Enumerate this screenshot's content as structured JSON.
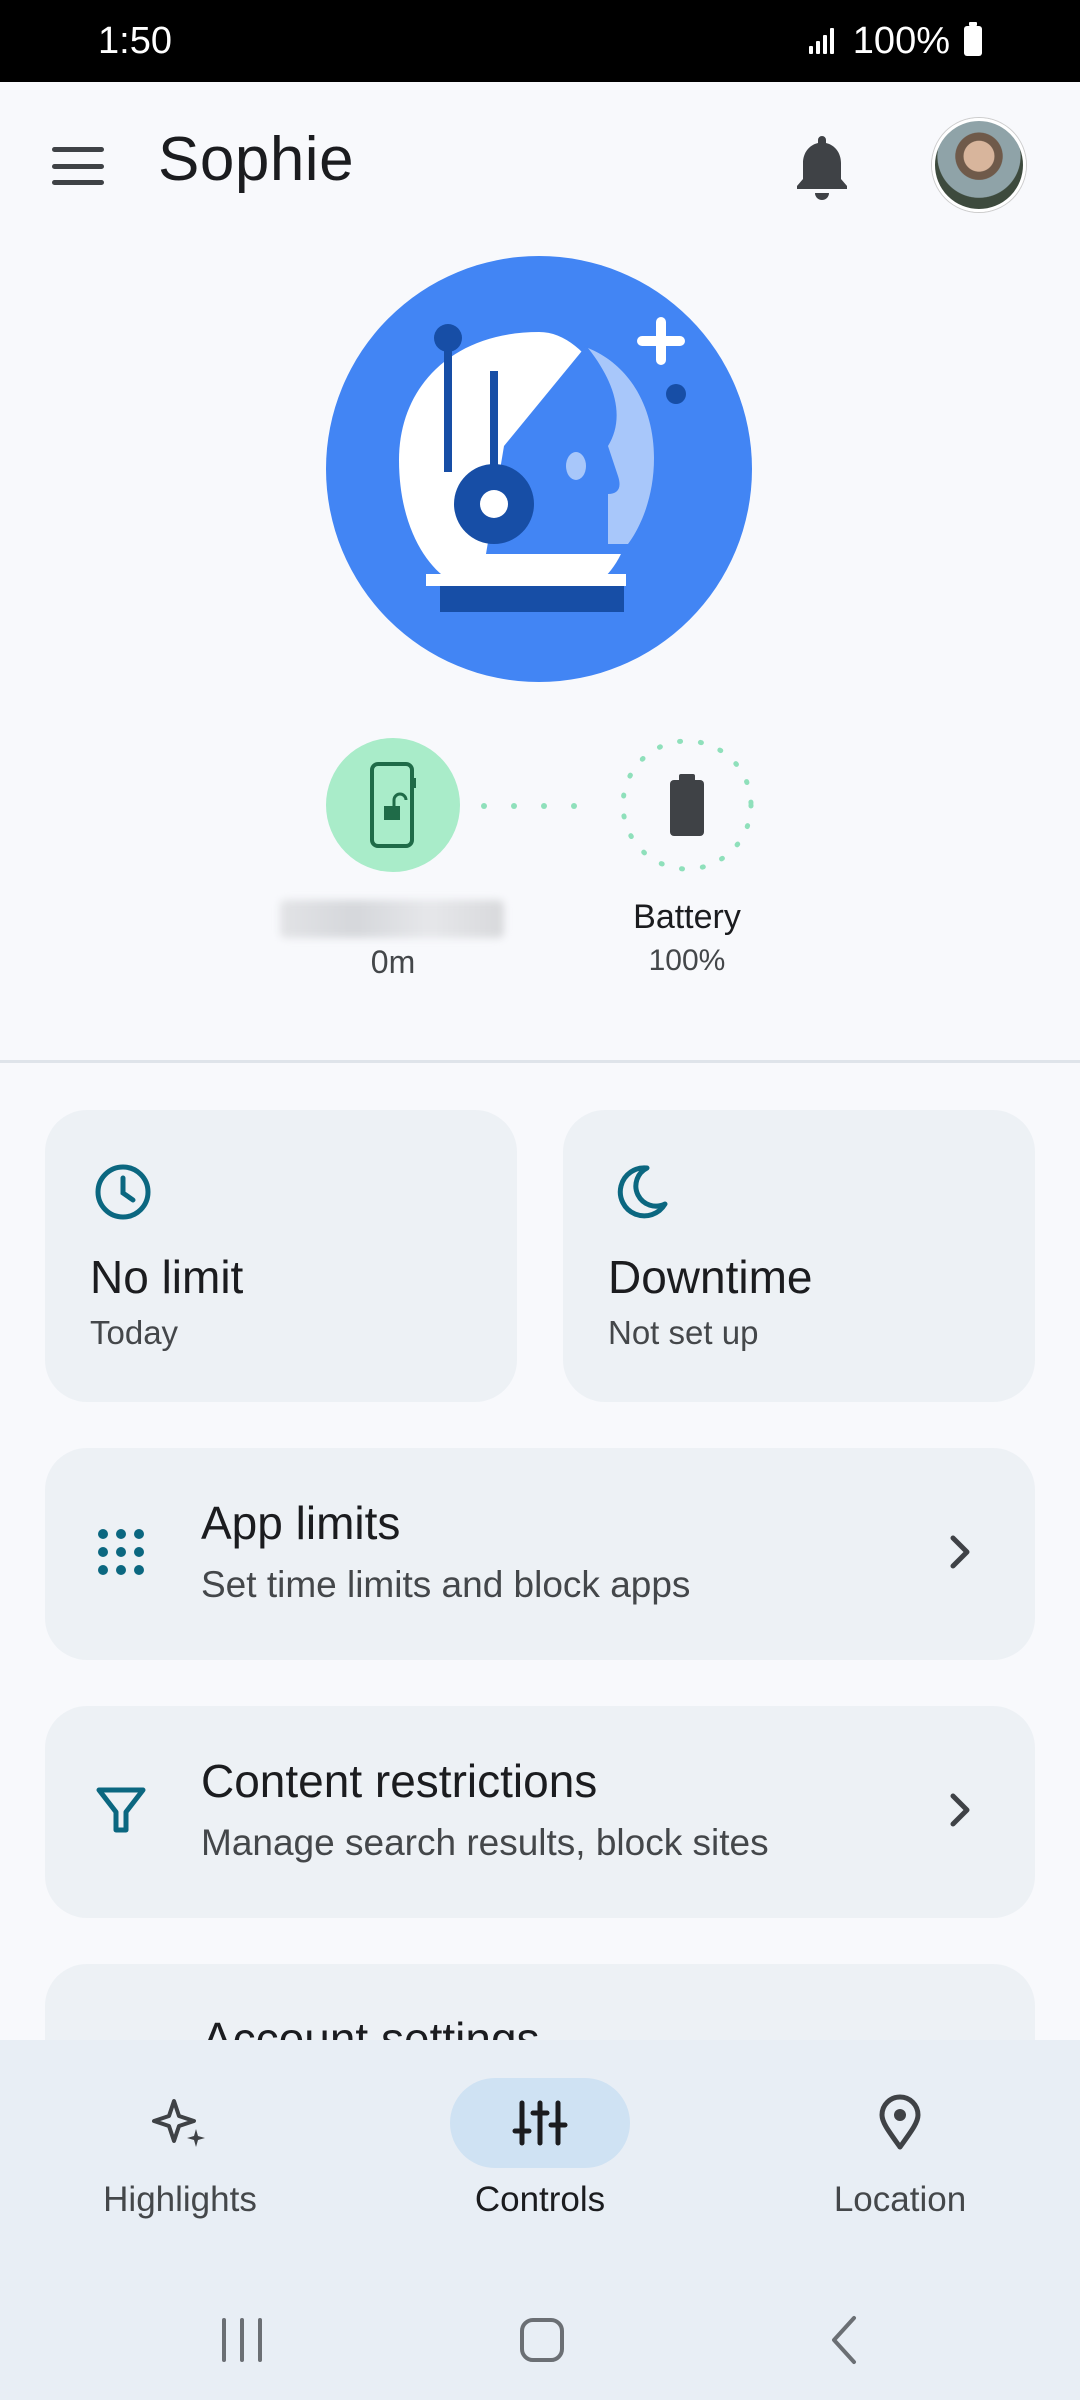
{
  "status_bar": {
    "time": "1:50",
    "battery_text": "100%"
  },
  "app_bar": {
    "title": "Sophie",
    "menu_icon": "menu-icon",
    "notification_icon": "bell-icon",
    "avatar": "profile-avatar"
  },
  "device": {
    "time_used": "0m",
    "battery_label": "Battery",
    "battery_value": "100%"
  },
  "cards": {
    "screen_time": {
      "icon": "clock-icon",
      "title": "No limit",
      "subtitle": "Today"
    },
    "downtime": {
      "icon": "moon-icon",
      "title": "Downtime",
      "subtitle": "Not set up"
    }
  },
  "rows": {
    "app_limits": {
      "icon": "grid-icon",
      "title": "App limits",
      "subtitle": "Set time limits and block apps"
    },
    "content_restrictions": {
      "icon": "filter-icon",
      "title": "Content restrictions",
      "subtitle": "Manage search results, block sites"
    },
    "account_settings": {
      "title": "Account settings"
    }
  },
  "bottom_nav": {
    "items": [
      {
        "label": "Highlights",
        "icon": "sparkle-icon",
        "active": false
      },
      {
        "label": "Controls",
        "icon": "sliders-icon",
        "active": true
      },
      {
        "label": "Location",
        "icon": "location-pin-icon",
        "active": false
      }
    ]
  },
  "colors": {
    "accent_blue": "#4285f4",
    "dark_blue": "#174ea6",
    "teal_icon": "#0b6780",
    "green_bg": "#a9ecc9",
    "card_bg": "#edf1f5",
    "nav_bg": "#e8eef5",
    "nav_active": "#cfe2f3"
  }
}
